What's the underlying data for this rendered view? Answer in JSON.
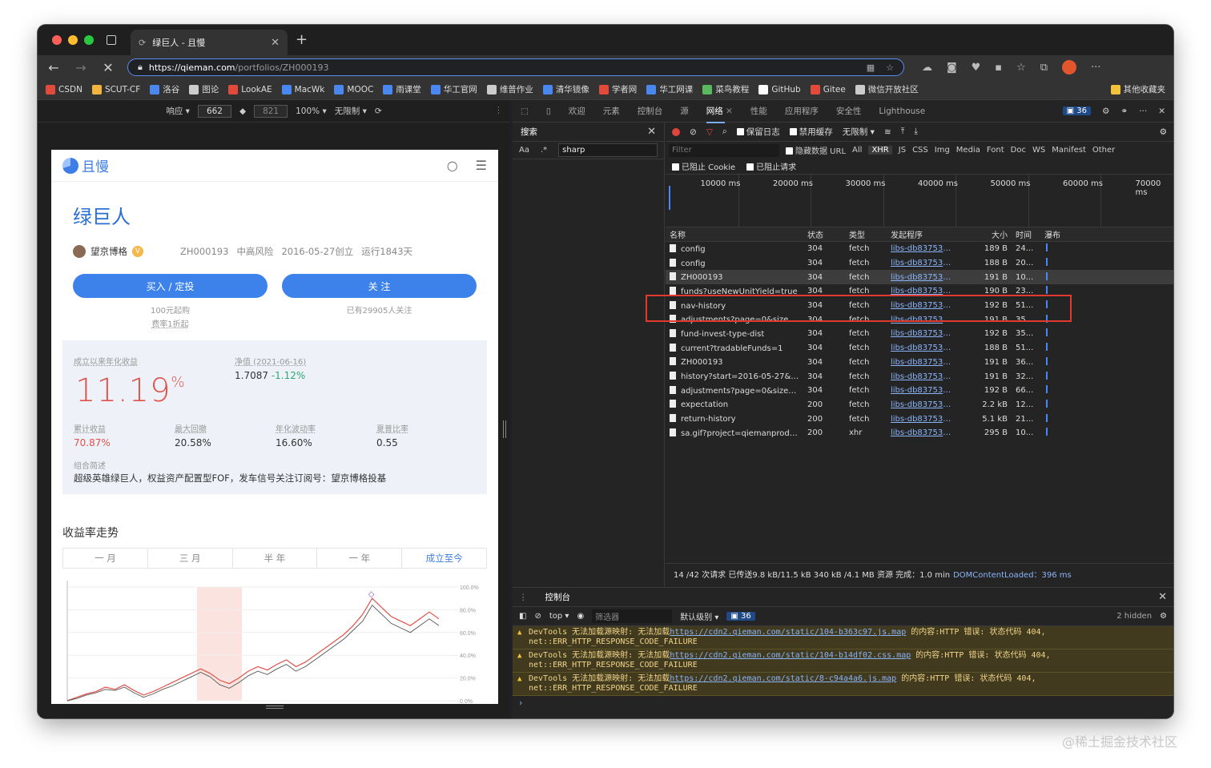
{
  "browser": {
    "tab_title": "绿巨人 - 且慢",
    "url_host": "https://qieman.com",
    "url_path": "/portfolios/ZH000193",
    "bookmarks": [
      "CSDN",
      "SCUT-CF",
      "洛谷",
      "图论",
      "LookAE",
      "MacWk",
      "MOOC",
      "雨课堂",
      "华工官网",
      "维普作业",
      "清华镜像",
      "学者网",
      "华工网课",
      "菜鸟教程",
      "GitHub",
      "Gitee",
      "微信开放社区"
    ],
    "bookmark_colors": [
      "#e24a3b",
      "#f2b43a",
      "#4a88f0",
      "#cccccc",
      "#e24a3b",
      "#4a88f0",
      "#4a88f0",
      "#4a88f0",
      "#4a88f0",
      "#cccccc",
      "#4a88f0",
      "#e24a3b",
      "#4a88f0",
      "#5cb85c",
      "#ffffff",
      "#e24a3b",
      "#cccccc"
    ],
    "other_bookmarks": "其他收藏夹"
  },
  "emulation": {
    "mode": "响应 ▾",
    "width": "662",
    "height": "821",
    "zoom": "100% ▾",
    "throttle": "无限制 ▾"
  },
  "page": {
    "logo_text": "且慢",
    "fund_name": "绿巨人",
    "manager": "望京博格",
    "code": "ZH000193",
    "risk": "中高风险",
    "created": "2016-05-27创立",
    "running": "运行1843天",
    "buy_btn": "买入 / 定投",
    "follow_btn": "关 注",
    "min_buy": "100元起购",
    "fee": "费率1折起",
    "followers": "已有29905人关注",
    "annual_label": "成立以来年化收益",
    "annual_value": "11.19",
    "annual_unit": "%",
    "nav_label": "净值 (2021-06-16)",
    "nav_value": "1.7087",
    "nav_change": "-1.12%",
    "stats": [
      {
        "label": "累计收益",
        "value": "70.87%"
      },
      {
        "label": "最大回撤",
        "value": "20.58%"
      },
      {
        "label": "年化波动率",
        "value": "16.60%"
      },
      {
        "label": "夏普比率",
        "value": "0.55"
      }
    ],
    "desc_label": "组合简述",
    "desc": "超级英雄绿巨人，权益资产配置型FOF，发车信号关注订阅号：望京博格投基",
    "section_title": "收益率走势",
    "periods": [
      "一 月",
      "三 月",
      "半 年",
      "一 年",
      "成立至今"
    ]
  },
  "chart_data": {
    "type": "line",
    "title": "",
    "xlabel": "",
    "ylabel": "",
    "ylim": [
      0,
      100
    ],
    "y_ticks": [
      "100.0%",
      "80.0%",
      "60.0%",
      "40.0%",
      "20.0%",
      "0.0%"
    ],
    "series": [
      {
        "values": [
          0,
          3,
          6,
          8,
          12,
          10,
          14,
          9,
          5,
          8,
          12,
          16,
          20,
          24,
          28,
          24,
          18,
          15,
          20,
          26,
          30,
          27,
          32,
          36,
          30,
          34,
          40,
          46,
          52,
          58,
          66,
          76,
          90,
          82,
          74,
          70,
          66,
          72,
          78,
          72
        ]
      },
      {
        "values": [
          0,
          2,
          5,
          7,
          10,
          9,
          12,
          7,
          3,
          6,
          10,
          13,
          17,
          21,
          25,
          21,
          14,
          11,
          16,
          22,
          26,
          23,
          28,
          32,
          26,
          30,
          36,
          42,
          48,
          54,
          62,
          70,
          84,
          76,
          68,
          64,
          60,
          66,
          72,
          66
        ]
      }
    ]
  },
  "devtools": {
    "tabs": [
      "欢迎",
      "元素",
      "控制台",
      "源",
      "网络",
      "性能",
      "应用程序",
      "安全性",
      "Lighthouse"
    ],
    "issues": "36",
    "search_title": "搜索",
    "search_case": "Aa",
    "search_regex": ".*",
    "search_query": "sharp",
    "preserve_log": "保留日志",
    "disable_cache": "禁用缓存",
    "throttle": "无限制",
    "filter_placeholder": "Filter",
    "hide_data_url": "隐藏数据 URL",
    "types": [
      "All",
      "XHR",
      "JS",
      "CSS",
      "Img",
      "Media",
      "Font",
      "Doc",
      "WS",
      "Manifest",
      "Other"
    ],
    "blocked_cookie": "已阻止 Cookie",
    "blocked_req": "已阻止请求",
    "timeline_ticks": [
      "10000 ms",
      "20000 ms",
      "30000 ms",
      "40000 ms",
      "50000 ms",
      "60000 ms",
      "70000 ms"
    ],
    "columns": [
      "名称",
      "状态",
      "类型",
      "发起程序",
      "大小",
      "时间",
      "瀑布"
    ],
    "rows": [
      {
        "name": "config",
        "status": "304",
        "type": "fetch",
        "init": "libs-db83753.j...",
        "size": "189 B",
        "time": "24..."
      },
      {
        "name": "config",
        "status": "304",
        "type": "fetch",
        "init": "libs-db83753.j...",
        "size": "188 B",
        "time": "20..."
      },
      {
        "name": "ZH000193",
        "status": "304",
        "type": "fetch",
        "init": "libs-db83753.j...",
        "size": "191 B",
        "time": "10..."
      },
      {
        "name": "funds?useNewUnitYield=true",
        "status": "304",
        "type": "fetch",
        "init": "libs-db83753.j...",
        "size": "190 B",
        "time": "23..."
      },
      {
        "name": "nav-history",
        "status": "304",
        "type": "fetch",
        "init": "libs-db83753.j...",
        "size": "192 B",
        "time": "51..."
      },
      {
        "name": "adjustments?page=0&size=5&...",
        "status": "304",
        "type": "fetch",
        "init": "libs-db83753.j...",
        "size": "191 B",
        "time": "35..."
      },
      {
        "name": "fund-invest-type-dist",
        "status": "304",
        "type": "fetch",
        "init": "libs-db83753.j...",
        "size": "192 B",
        "time": "35..."
      },
      {
        "name": "current?tradableFunds=1",
        "status": "304",
        "type": "fetch",
        "init": "libs-db83753.j...",
        "size": "188 B",
        "time": "51..."
      },
      {
        "name": "ZH000193",
        "status": "304",
        "type": "fetch",
        "init": "libs-db83753.j...",
        "size": "191 B",
        "time": "36..."
      },
      {
        "name": "history?start=2016-05-27&end...",
        "status": "304",
        "type": "fetch",
        "init": "libs-db83753.j...",
        "size": "191 B",
        "time": "32..."
      },
      {
        "name": "adjustments?page=0&size=25...",
        "status": "304",
        "type": "fetch",
        "init": "libs-db83753.j...",
        "size": "192 B",
        "time": "66..."
      },
      {
        "name": "expectation",
        "status": "200",
        "type": "fetch",
        "init": "libs-db83753.j...",
        "size": "2.2 kB",
        "time": "12..."
      },
      {
        "name": "return-history",
        "status": "200",
        "type": "fetch",
        "init": "libs-db83753.j...",
        "size": "5.1 kB",
        "time": "21..."
      },
      {
        "name": "sa.gif?project=qiemanproducti...",
        "status": "200",
        "type": "xhr",
        "init": "libs-db83753.j...",
        "size": "295 B",
        "time": "10..."
      }
    ],
    "status_text": "14 /42 次请求  已传送9.8 kB/11.5 kB  340 kB /4.1 MB 资源  完成：1.0 min",
    "status_dcl": "DOMContentLoaded：396 ms",
    "console_title": "控制台",
    "console_context": "top ▾",
    "console_filter": "筛选器",
    "console_level": "默认级别 ▾",
    "console_issues": "36",
    "console_hidden": "2 hidden",
    "warnings": [
      {
        "pre": "DevTools 无法加载源映射: 无法加载",
        "url": "https://cdn2.qieman.com/static/104-b363c97.js.map",
        "post": " 的内容:HTTP 错误: 状态代码 404,",
        "line2": "net::ERR_HTTP_RESPONSE_CODE_FAILURE"
      },
      {
        "pre": "DevTools 无法加载源映射: 无法加载",
        "url": "https://cdn2.qieman.com/static/104-b14df02.css.map",
        "post": " 的内容:HTTP 错误: 状态代码 404,",
        "line2": "net::ERR_HTTP_RESPONSE_CODE_FAILURE"
      },
      {
        "pre": "DevTools 无法加载源映射: 无法加载",
        "url": "https://cdn2.qieman.com/static/8-c94a4a6.js.map",
        "post": " 的内容:HTTP 错误: 状态代码 404,",
        "line2": "net::ERR_HTTP_RESPONSE_CODE_FAILURE"
      }
    ]
  },
  "watermark": "@稀土掘金技术社区"
}
